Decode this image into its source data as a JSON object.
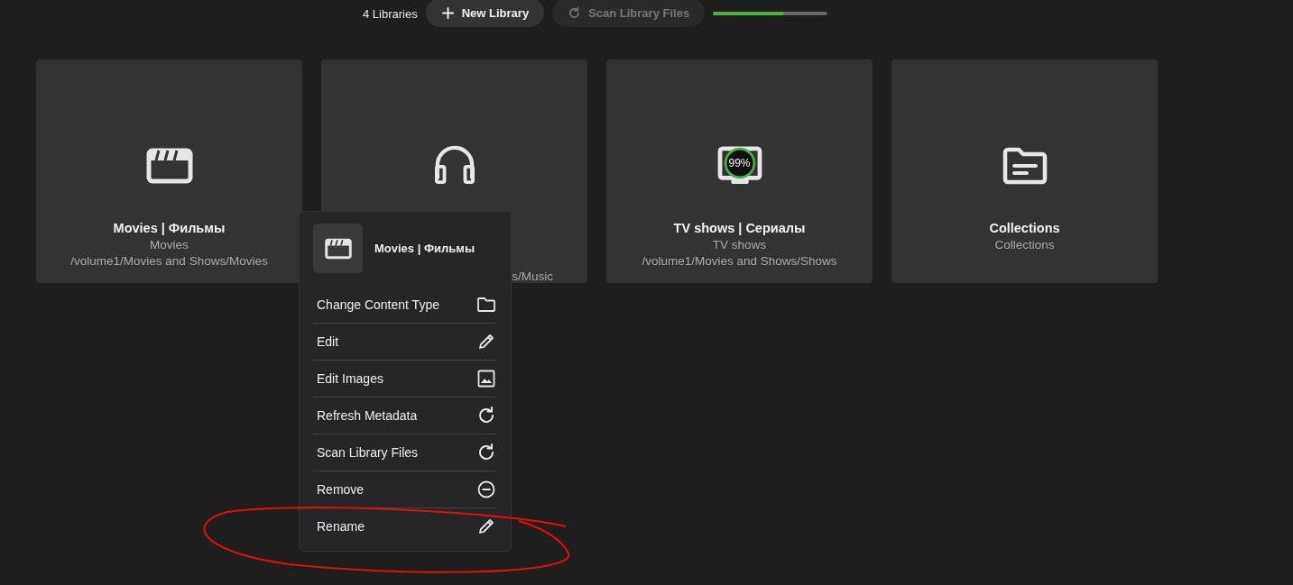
{
  "toolbar": {
    "count": "4 Libraries",
    "new_button": {
      "label": "New Library"
    },
    "scan_button": {
      "label": "Scan Library Files",
      "disabled": true
    },
    "scan_progress": {
      "level": 0.61
    }
  },
  "libraries": [
    {
      "kind": "clapperboard",
      "title": "Movies | Фильмы",
      "type": "Movies",
      "path": "/volume1/Movies and Shows/Movies"
    },
    {
      "kind": "headphones",
      "path": "s/Music"
    },
    {
      "kind": "tv",
      "badge": {
        "text": "99%"
      },
      "title": "TV shows | Сериалы",
      "type": "TV shows",
      "path": "/volume1/Movies and Shows/Shows"
    },
    {
      "kind": "folder",
      "title": "Collections",
      "type": "Collections"
    }
  ],
  "context_menu": {
    "kind": "clapperboard",
    "title": "Movies | Фильмы",
    "items": [
      {
        "label": "Change Content Type",
        "kind": "folder"
      },
      {
        "label": "Edit",
        "kind": "pencil"
      },
      {
        "label": "Edit Images",
        "kind": "image"
      },
      {
        "label": "Refresh Metadata",
        "kind": "refresh"
      },
      {
        "label": "Scan Library Files",
        "kind": "refresh"
      },
      {
        "label": "Remove",
        "kind": "remove"
      },
      {
        "label": "Rename",
        "kind": "pencil"
      }
    ]
  }
}
